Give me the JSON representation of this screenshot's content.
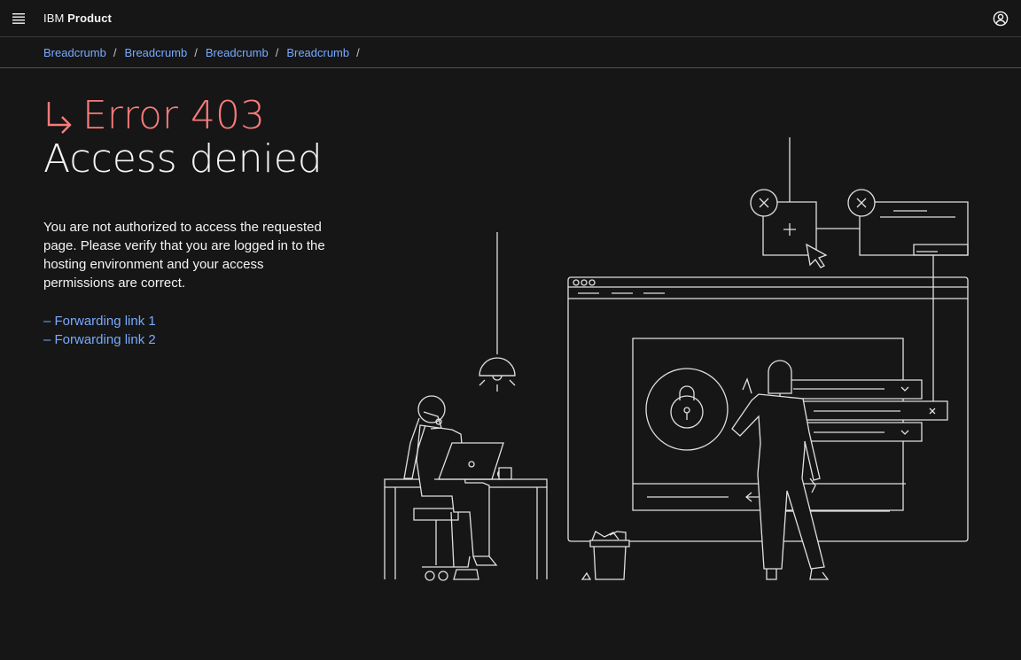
{
  "header": {
    "brand_prefix": "IBM",
    "brand_product": "Product",
    "menu_icon": "hamburger-menu-icon",
    "user_icon": "user-avatar-icon"
  },
  "breadcrumbs": [
    {
      "label": "Breadcrumb"
    },
    {
      "label": "Breadcrumb"
    },
    {
      "label": "Breadcrumb"
    },
    {
      "label": "Breadcrumb"
    }
  ],
  "breadcrumb_separator": "/",
  "error": {
    "code": "Error 403",
    "title": "Access denied",
    "description": "You are not authorized to access the requested page. Please verify that you are logged in to the hosting environment and your access permissions are correct.",
    "arrow_icon": "return-arrow-icon"
  },
  "links": [
    {
      "label": "– Forwarding link 1"
    },
    {
      "label": "– Forwarding link 2"
    }
  ],
  "colors": {
    "background": "#161616",
    "text": "#f4f4f4",
    "link": "#78a9ff",
    "error": "#fa7b7b",
    "border": "#393939"
  }
}
